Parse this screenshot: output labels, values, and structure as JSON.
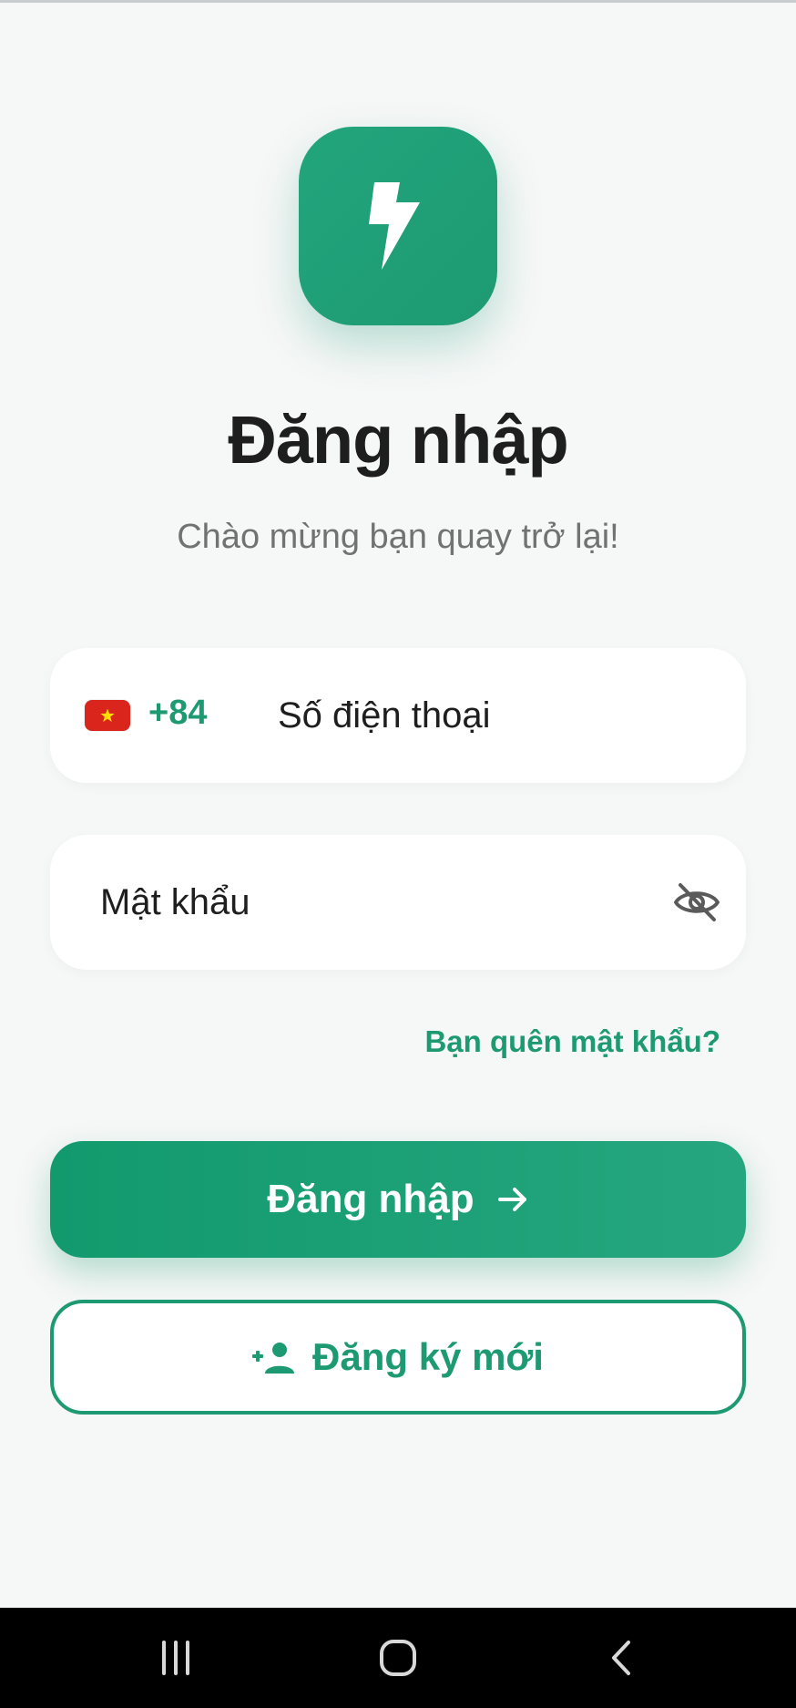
{
  "header": {
    "title": "Đăng nhập",
    "subtitle": "Chào mừng bạn quay trở lại!"
  },
  "logo": {
    "icon": "lightning-bolt-icon"
  },
  "phone_field": {
    "country_flag": "vietnam-flag-icon",
    "dial_code": "+84",
    "placeholder": "Số điện thoại",
    "value": ""
  },
  "password_field": {
    "placeholder": "Mật khẩu",
    "value": "",
    "toggle_icon": "eye-off-icon"
  },
  "forgot_password": {
    "label": "Bạn quên mật khẩu?"
  },
  "login_button": {
    "label": "Đăng nhập",
    "icon": "arrow-right-icon"
  },
  "register_button": {
    "label": "Đăng ký mới",
    "icon": "person-add-icon"
  },
  "system_nav": {
    "recent_icon": "recent-apps-icon",
    "home_icon": "home-icon",
    "back_icon": "back-icon"
  },
  "colors": {
    "accent": "#1d9a72",
    "background": "#f6f7f7",
    "title": "#1e1e1e",
    "subtitle": "#727272",
    "flag_red": "#da251d",
    "flag_star": "#ffde00"
  }
}
